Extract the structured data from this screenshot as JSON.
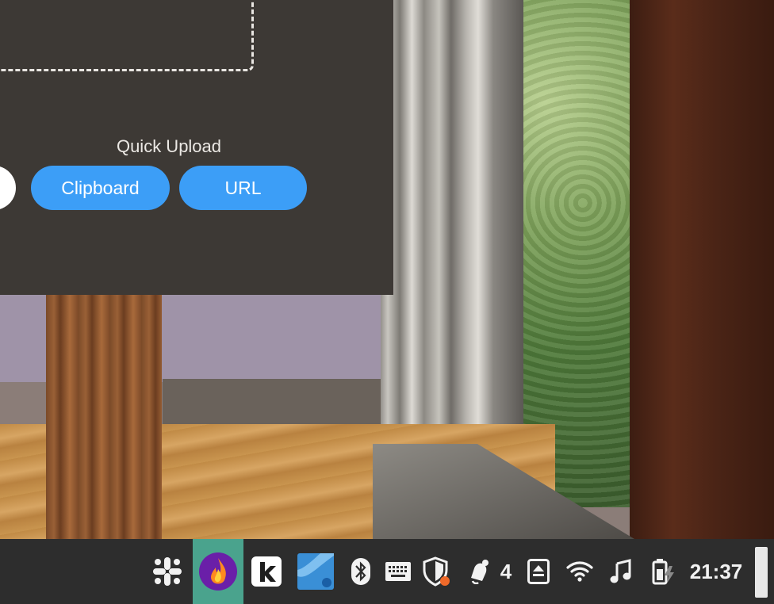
{
  "dialog": {
    "quick_upload_title": "Quick Upload",
    "buttons": {
      "clipboard": "Clipboard",
      "url": "URL"
    }
  },
  "taskbar": {
    "apps": [
      {
        "icon": "slack-icon"
      },
      {
        "icon": "flameshot-icon",
        "active": true
      },
      {
        "icon": "kdeconnect-icon"
      },
      {
        "icon": "image-viewer-icon"
      }
    ],
    "tray": {
      "bluetooth": "bluetooth-icon",
      "keyboard": "keyboard-icon",
      "security": "shield-icon",
      "notifications_count": "4",
      "removable_media": "eject-icon",
      "wifi": "wifi-icon",
      "media": "music-note-icon",
      "battery": "battery-charging-icon"
    },
    "clock": "21:37"
  },
  "colors": {
    "dialog_bg": "#3d3935",
    "accent": "#3c9ef7",
    "taskbar_bg": "#2d2d2d",
    "active_app_bg": "#4aa38d"
  }
}
